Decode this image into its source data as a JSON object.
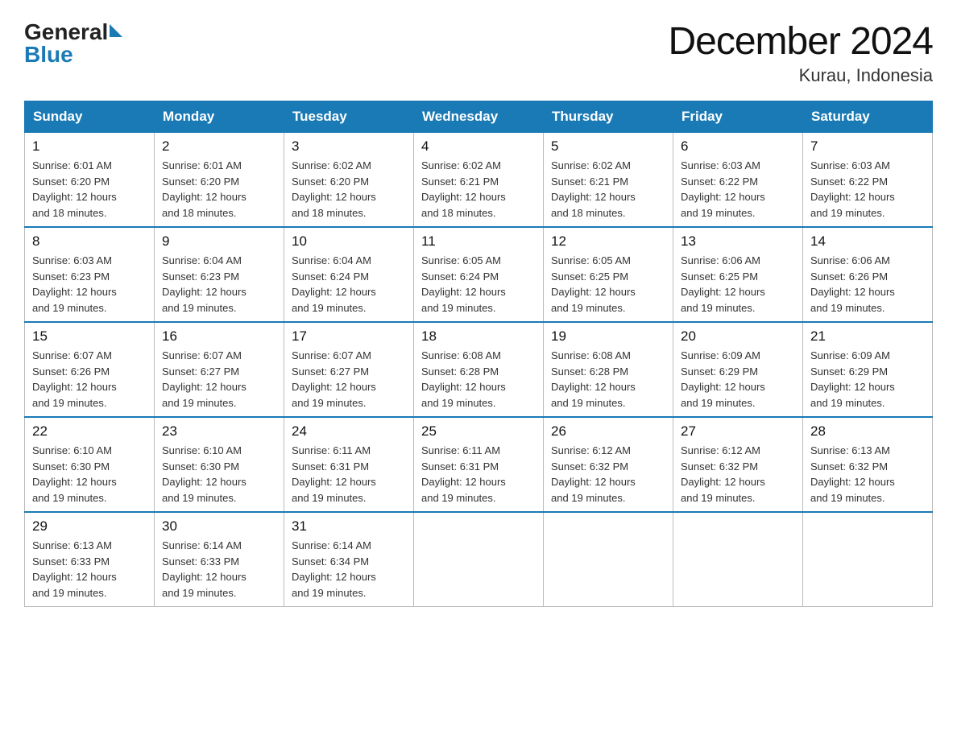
{
  "header": {
    "logo_general": "General",
    "logo_blue": "Blue",
    "title": "December 2024",
    "subtitle": "Kurau, Indonesia"
  },
  "calendar": {
    "headers": [
      "Sunday",
      "Monday",
      "Tuesday",
      "Wednesday",
      "Thursday",
      "Friday",
      "Saturday"
    ],
    "weeks": [
      [
        {
          "day": "1",
          "sunrise": "6:01 AM",
          "sunset": "6:20 PM",
          "daylight": "12 hours and 18 minutes."
        },
        {
          "day": "2",
          "sunrise": "6:01 AM",
          "sunset": "6:20 PM",
          "daylight": "12 hours and 18 minutes."
        },
        {
          "day": "3",
          "sunrise": "6:02 AM",
          "sunset": "6:20 PM",
          "daylight": "12 hours and 18 minutes."
        },
        {
          "day": "4",
          "sunrise": "6:02 AM",
          "sunset": "6:21 PM",
          "daylight": "12 hours and 18 minutes."
        },
        {
          "day": "5",
          "sunrise": "6:02 AM",
          "sunset": "6:21 PM",
          "daylight": "12 hours and 18 minutes."
        },
        {
          "day": "6",
          "sunrise": "6:03 AM",
          "sunset": "6:22 PM",
          "daylight": "12 hours and 19 minutes."
        },
        {
          "day": "7",
          "sunrise": "6:03 AM",
          "sunset": "6:22 PM",
          "daylight": "12 hours and 19 minutes."
        }
      ],
      [
        {
          "day": "8",
          "sunrise": "6:03 AM",
          "sunset": "6:23 PM",
          "daylight": "12 hours and 19 minutes."
        },
        {
          "day": "9",
          "sunrise": "6:04 AM",
          "sunset": "6:23 PM",
          "daylight": "12 hours and 19 minutes."
        },
        {
          "day": "10",
          "sunrise": "6:04 AM",
          "sunset": "6:24 PM",
          "daylight": "12 hours and 19 minutes."
        },
        {
          "day": "11",
          "sunrise": "6:05 AM",
          "sunset": "6:24 PM",
          "daylight": "12 hours and 19 minutes."
        },
        {
          "day": "12",
          "sunrise": "6:05 AM",
          "sunset": "6:25 PM",
          "daylight": "12 hours and 19 minutes."
        },
        {
          "day": "13",
          "sunrise": "6:06 AM",
          "sunset": "6:25 PM",
          "daylight": "12 hours and 19 minutes."
        },
        {
          "day": "14",
          "sunrise": "6:06 AM",
          "sunset": "6:26 PM",
          "daylight": "12 hours and 19 minutes."
        }
      ],
      [
        {
          "day": "15",
          "sunrise": "6:07 AM",
          "sunset": "6:26 PM",
          "daylight": "12 hours and 19 minutes."
        },
        {
          "day": "16",
          "sunrise": "6:07 AM",
          "sunset": "6:27 PM",
          "daylight": "12 hours and 19 minutes."
        },
        {
          "day": "17",
          "sunrise": "6:07 AM",
          "sunset": "6:27 PM",
          "daylight": "12 hours and 19 minutes."
        },
        {
          "day": "18",
          "sunrise": "6:08 AM",
          "sunset": "6:28 PM",
          "daylight": "12 hours and 19 minutes."
        },
        {
          "day": "19",
          "sunrise": "6:08 AM",
          "sunset": "6:28 PM",
          "daylight": "12 hours and 19 minutes."
        },
        {
          "day": "20",
          "sunrise": "6:09 AM",
          "sunset": "6:29 PM",
          "daylight": "12 hours and 19 minutes."
        },
        {
          "day": "21",
          "sunrise": "6:09 AM",
          "sunset": "6:29 PM",
          "daylight": "12 hours and 19 minutes."
        }
      ],
      [
        {
          "day": "22",
          "sunrise": "6:10 AM",
          "sunset": "6:30 PM",
          "daylight": "12 hours and 19 minutes."
        },
        {
          "day": "23",
          "sunrise": "6:10 AM",
          "sunset": "6:30 PM",
          "daylight": "12 hours and 19 minutes."
        },
        {
          "day": "24",
          "sunrise": "6:11 AM",
          "sunset": "6:31 PM",
          "daylight": "12 hours and 19 minutes."
        },
        {
          "day": "25",
          "sunrise": "6:11 AM",
          "sunset": "6:31 PM",
          "daylight": "12 hours and 19 minutes."
        },
        {
          "day": "26",
          "sunrise": "6:12 AM",
          "sunset": "6:32 PM",
          "daylight": "12 hours and 19 minutes."
        },
        {
          "day": "27",
          "sunrise": "6:12 AM",
          "sunset": "6:32 PM",
          "daylight": "12 hours and 19 minutes."
        },
        {
          "day": "28",
          "sunrise": "6:13 AM",
          "sunset": "6:32 PM",
          "daylight": "12 hours and 19 minutes."
        }
      ],
      [
        {
          "day": "29",
          "sunrise": "6:13 AM",
          "sunset": "6:33 PM",
          "daylight": "12 hours and 19 minutes."
        },
        {
          "day": "30",
          "sunrise": "6:14 AM",
          "sunset": "6:33 PM",
          "daylight": "12 hours and 19 minutes."
        },
        {
          "day": "31",
          "sunrise": "6:14 AM",
          "sunset": "6:34 PM",
          "daylight": "12 hours and 19 minutes."
        },
        null,
        null,
        null,
        null
      ]
    ]
  }
}
